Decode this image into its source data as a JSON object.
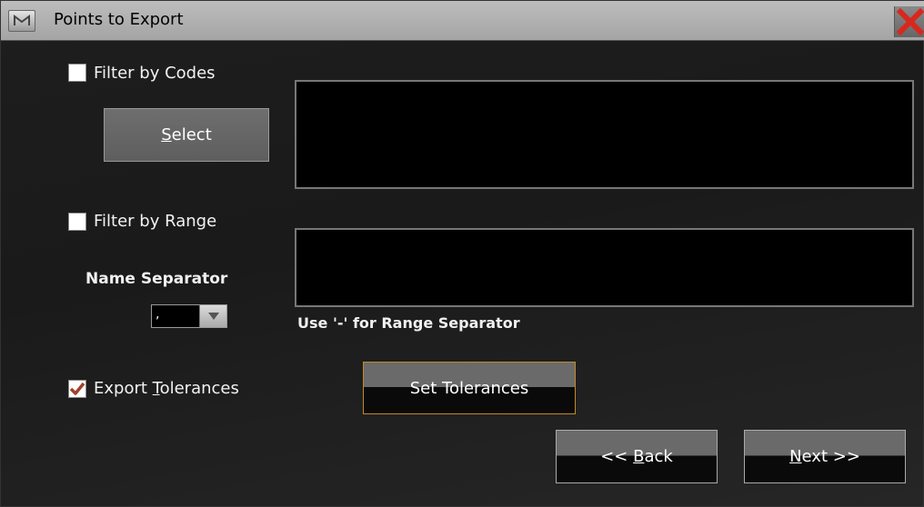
{
  "window": {
    "title": "Points to Export"
  },
  "filter_codes": {
    "label": "Filter by Codes",
    "checked": false,
    "select_button": "Select"
  },
  "filter_range": {
    "label": "Filter by Range",
    "checked": false
  },
  "name_separator": {
    "label": "Name Separator",
    "value": ","
  },
  "range_hint": "Use '-' for Range Separator",
  "export_tolerances": {
    "label_prefix": "Export ",
    "label_underlined": "T",
    "label_suffix": "olerances",
    "checked": true
  },
  "set_tolerances_button": "Set Tolerances",
  "nav": {
    "back_prefix": "<< ",
    "back_underlined": "B",
    "back_suffix": "ack",
    "next_underlined": "N",
    "next_suffix": "ext >>"
  },
  "select_underlined": "S",
  "select_suffix": "elect",
  "colors": {
    "checkmark": "#a0432a",
    "focus_border": "#c08a2a",
    "close_x": "#d8281e"
  }
}
